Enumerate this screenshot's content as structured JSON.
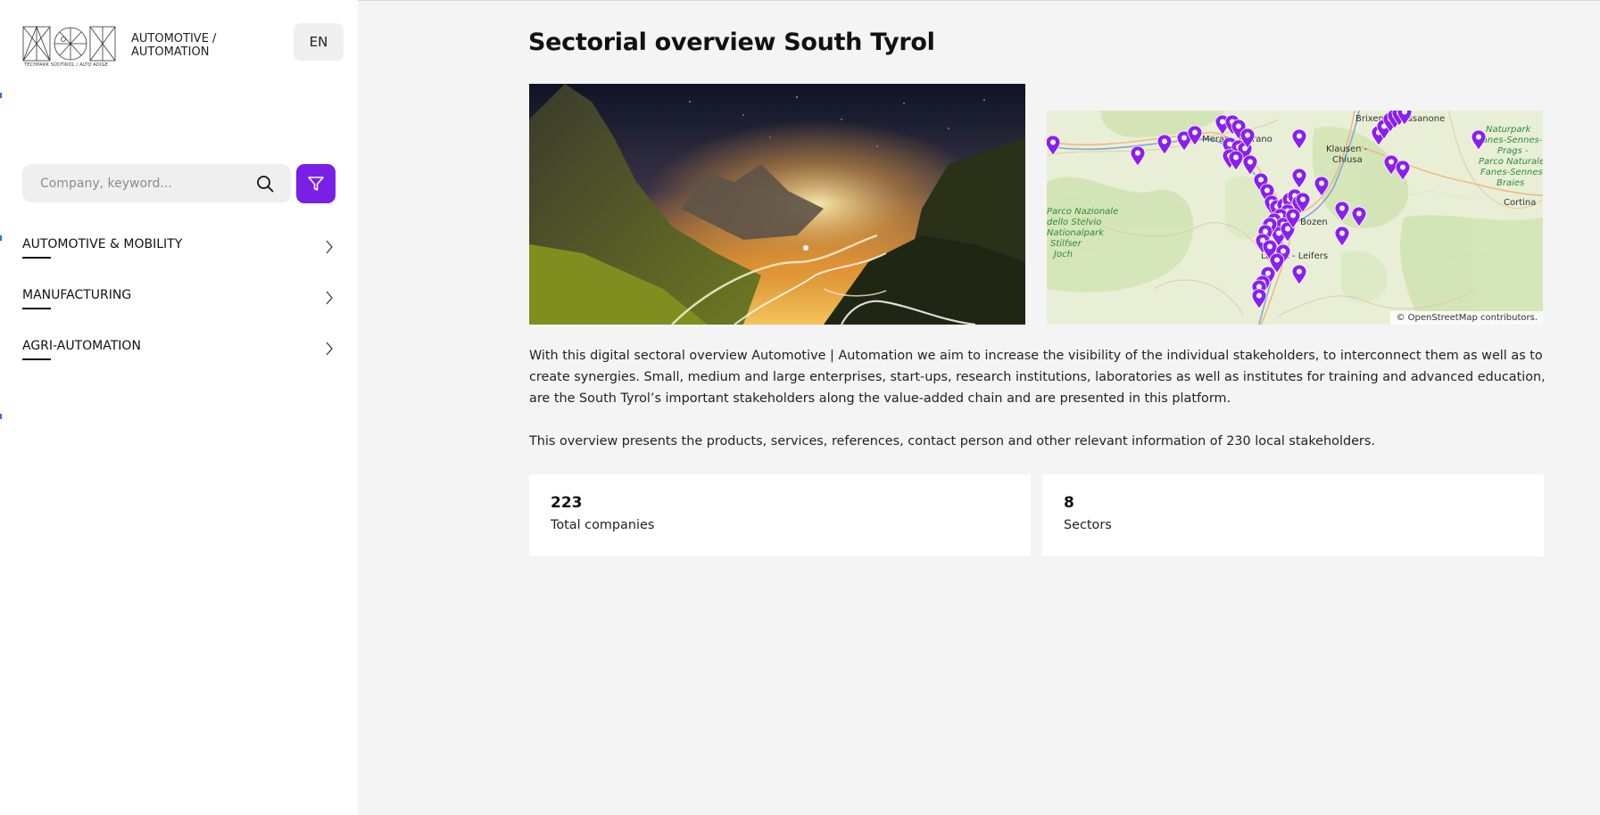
{
  "header": {
    "logo_subtitle": "TECHPARK SÜDTIROL / ALTO ADIGE",
    "brand_line1": "AUTOMOTIVE /",
    "brand_line2": "AUTOMATION",
    "language": "EN"
  },
  "sidebar": {
    "search_placeholder": "Company, keyword...",
    "items": [
      {
        "label": "AUTOMOTIVE & MOBILITY"
      },
      {
        "label": "MANUFACTURING"
      },
      {
        "label": "AGRI-AUTOMATION"
      }
    ]
  },
  "main": {
    "title": "Sectorial overview South Tyrol",
    "paragraph1": "With this digital sectoral overview Automotive | Automation we aim to increase the visibility of the individual stakeholders, to interconnect them as well as to create synergies. Small, medium and large enterprises, start-ups, research institutions, laboratories as well as institutes for training and advanced education, are the South Tyrol’s important stakeholders along the value-added chain and are presented in this platform.",
    "paragraph2": "This overview presents the products, services, references, contact person and other relevant information of 230 local stakeholders.",
    "stats": [
      {
        "value": "223",
        "label": "Total companies"
      },
      {
        "value": "8",
        "label": "Sectors"
      }
    ]
  },
  "map": {
    "attribution": "© OpenStreetMap contributors.",
    "labels": {
      "merano": "Meran - Merano",
      "brixen": "Brixen - Bressanone",
      "klausen1": "Klausen -",
      "klausen2": "Chiusa",
      "bozen": "Bozen",
      "leifers": "Laives - Leifers",
      "stelvio1": "Parco Nazionale",
      "stelvio2": "dello Stelvio",
      "stelvio3": "Nationalpark",
      "stelvio4": "Stilfser",
      "stelvio5": "Joch",
      "fanes1": "Naturpark",
      "fanes2": "Fanes-Sennes-",
      "fanes3": "Prags -",
      "fanes4": "Parco Naturale",
      "fanes5": "Fanes-Sennes-",
      "fanes6": "Braies",
      "cortina": "Cortina"
    }
  },
  "colors": {
    "accent": "#7a1fe6",
    "marker": "#8a1ff0",
    "sidebar_bg": "#ffffff",
    "page_bg": "#f4f4f4"
  },
  "icons": {
    "search": "search-icon",
    "filter": "filter-icon",
    "chevron": "chevron-right-icon",
    "marker": "map-marker-icon"
  }
}
